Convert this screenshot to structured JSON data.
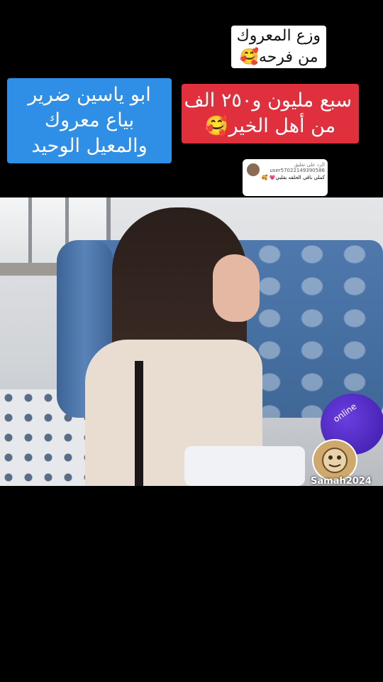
{
  "overlay": {
    "top_white_lines": [
      "وزع المعروك",
      "من فرحه🥰"
    ],
    "red_lines": [
      "سبع مليون و٢٥٠ الف",
      "من أهل الخير🥰"
    ],
    "blue_lines": [
      "ابو ياسين ضرير",
      "بياع معروك",
      "والمعيل الوحيد"
    ]
  },
  "reply_bubble": {
    "header": "الرد على تعليق",
    "username": "user57022149390586",
    "message": "كملي باقي الحلقه بقلبي💗",
    "extra_emoji": "🥰"
  },
  "video": {
    "mic_label": "online",
    "watermark": "Samah2024"
  },
  "colors": {
    "red_box": "#e0303e",
    "blue_box": "#2f8fe6",
    "mic": "#5a30d0"
  }
}
